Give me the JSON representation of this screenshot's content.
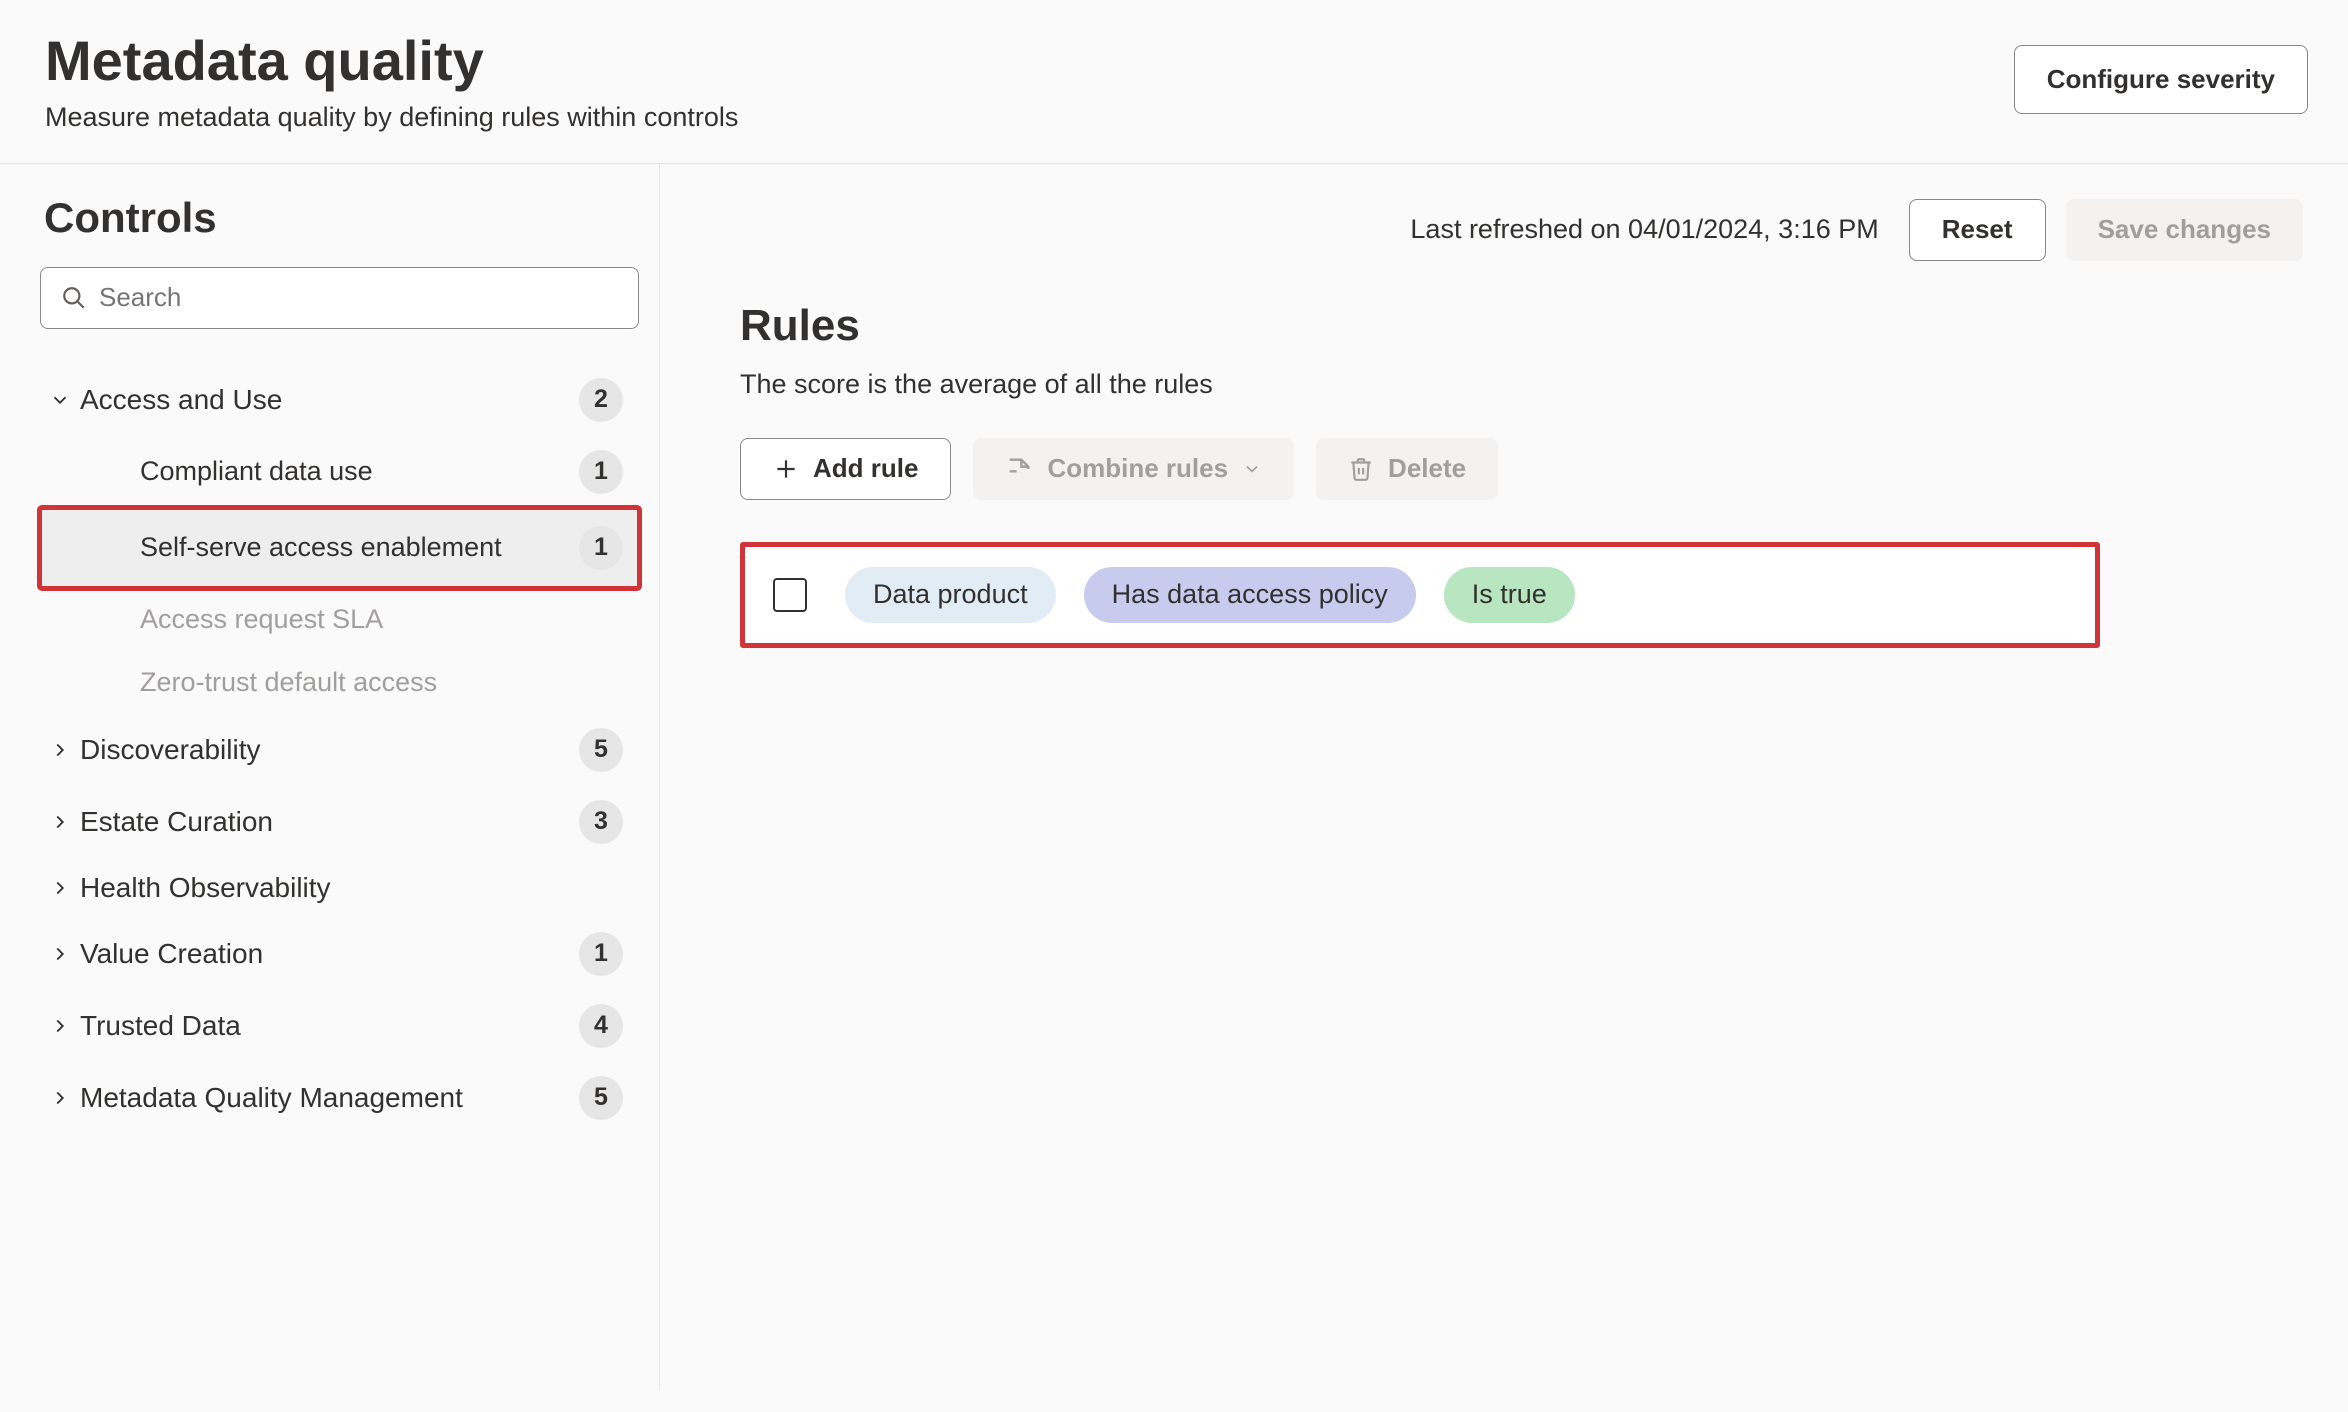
{
  "header": {
    "title": "Metadata quality",
    "subtitle": "Measure metadata quality by defining rules within controls",
    "configure_button": "Configure severity"
  },
  "sidebar": {
    "heading": "Controls",
    "search_placeholder": "Search",
    "groups": [
      {
        "label": "Access and Use",
        "badge": "2",
        "expanded": true,
        "items": [
          {
            "label": "Compliant data use",
            "badge": "1",
            "muted": false,
            "selected": false
          },
          {
            "label": "Self-serve access enablement",
            "badge": "1",
            "muted": false,
            "selected": true,
            "highlight": true
          },
          {
            "label": "Access request SLA",
            "badge": null,
            "muted": true,
            "selected": false
          },
          {
            "label": "Zero-trust default access",
            "badge": null,
            "muted": true,
            "selected": false
          }
        ]
      },
      {
        "label": "Discoverability",
        "badge": "5",
        "expanded": false
      },
      {
        "label": "Estate Curation",
        "badge": "3",
        "expanded": false
      },
      {
        "label": "Health Observability",
        "badge": null,
        "expanded": false
      },
      {
        "label": "Value Creation",
        "badge": "1",
        "expanded": false
      },
      {
        "label": "Trusted Data",
        "badge": "4",
        "expanded": false
      },
      {
        "label": "Metadata Quality Management",
        "badge": "5",
        "expanded": false
      }
    ]
  },
  "content": {
    "last_refreshed": "Last refreshed on 04/01/2024, 3:16 PM",
    "reset_button": "Reset",
    "save_button": "Save changes",
    "rules_heading": "Rules",
    "rules_desc": "The score is the average of all the rules",
    "add_rule_button": "Add rule",
    "combine_rules_button": "Combine rules",
    "delete_button": "Delete",
    "rule": {
      "subject": "Data product",
      "predicate": "Has data access policy",
      "value": "Is true"
    }
  }
}
